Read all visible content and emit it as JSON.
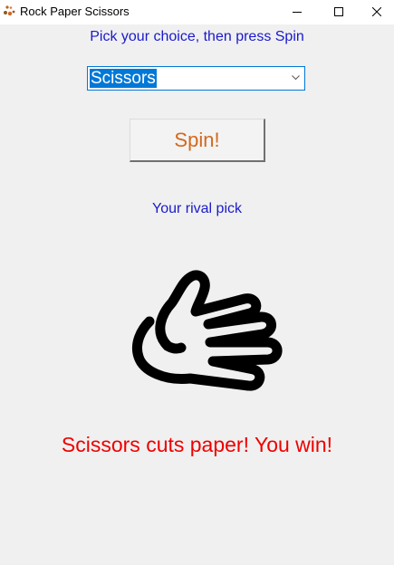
{
  "window": {
    "title": "Rock Paper Scissors",
    "app_icon": "rock-paper-scissors-app-icon",
    "controls": [
      "minimize-icon",
      "maximize-icon",
      "close-icon"
    ]
  },
  "prompt": {
    "text": "Pick your choice, then press Spin",
    "color": "#1a1acc"
  },
  "choice_select": {
    "selected": "Scissors",
    "arrow_icon": "chevron-down-icon",
    "highlight_color": "#0078d7"
  },
  "spin_button": {
    "label": "Spin!",
    "color": "#d2691e"
  },
  "rival": {
    "label": "Your rival pick",
    "label_color": "#1a1acc",
    "pick_icon": "paper-hand-icon"
  },
  "result": {
    "text": "Scissors cuts paper! You win!",
    "color": "#ee0000"
  }
}
